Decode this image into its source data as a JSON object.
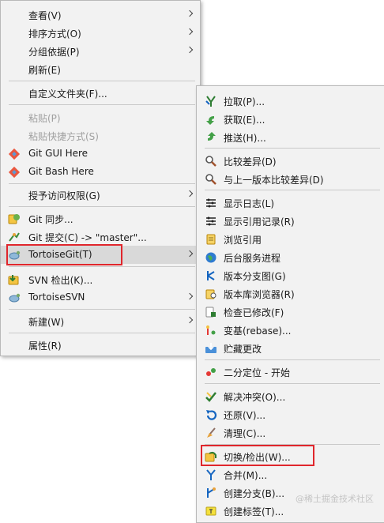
{
  "main_menu": {
    "items": [
      {
        "label": "查看(V)"
      },
      {
        "label": "排序方式(O)"
      },
      {
        "label": "分组依据(P)"
      },
      {
        "label": "刷新(E)"
      },
      {
        "label": "自定义文件夹(F)..."
      },
      {
        "label": "粘贴(P)"
      },
      {
        "label": "粘贴快捷方式(S)"
      },
      {
        "label": "Git GUI Here"
      },
      {
        "label": "Git Bash Here"
      },
      {
        "label": "授予访问权限(G)"
      },
      {
        "label": "Git 同步..."
      },
      {
        "label": "Git 提交(C) -> \"master\"..."
      },
      {
        "label": "TortoiseGit(T)"
      },
      {
        "label": "SVN 检出(K)..."
      },
      {
        "label": "TortoiseSVN"
      },
      {
        "label": "新建(W)"
      },
      {
        "label": "属性(R)"
      }
    ]
  },
  "sub_menu": {
    "items": [
      {
        "label": "拉取(P)..."
      },
      {
        "label": "获取(E)..."
      },
      {
        "label": "推送(H)..."
      },
      {
        "label": "比较差异(D)"
      },
      {
        "label": "与上一版本比较差异(D)"
      },
      {
        "label": "显示日志(L)"
      },
      {
        "label": "显示引用记录(R)"
      },
      {
        "label": "浏览引用"
      },
      {
        "label": "后台服务进程"
      },
      {
        "label": "版本分支图(G)"
      },
      {
        "label": "版本库浏览器(R)"
      },
      {
        "label": "检查已修改(F)"
      },
      {
        "label": "变基(rebase)..."
      },
      {
        "label": "贮藏更改"
      },
      {
        "label": "二分定位 - 开始"
      },
      {
        "label": "解决冲突(O)..."
      },
      {
        "label": "还原(V)..."
      },
      {
        "label": "清理(C)..."
      },
      {
        "label": "切换/检出(W)..."
      },
      {
        "label": "合并(M)..."
      },
      {
        "label": "创建分支(B)..."
      },
      {
        "label": "创建标签(T)..."
      }
    ]
  },
  "watermark": "@稀土掘金技术社区",
  "colors": {
    "highlight_box": "#e0262c",
    "menu_bg": "#f2f2f2",
    "hover_bg": "#d9d9d9"
  }
}
